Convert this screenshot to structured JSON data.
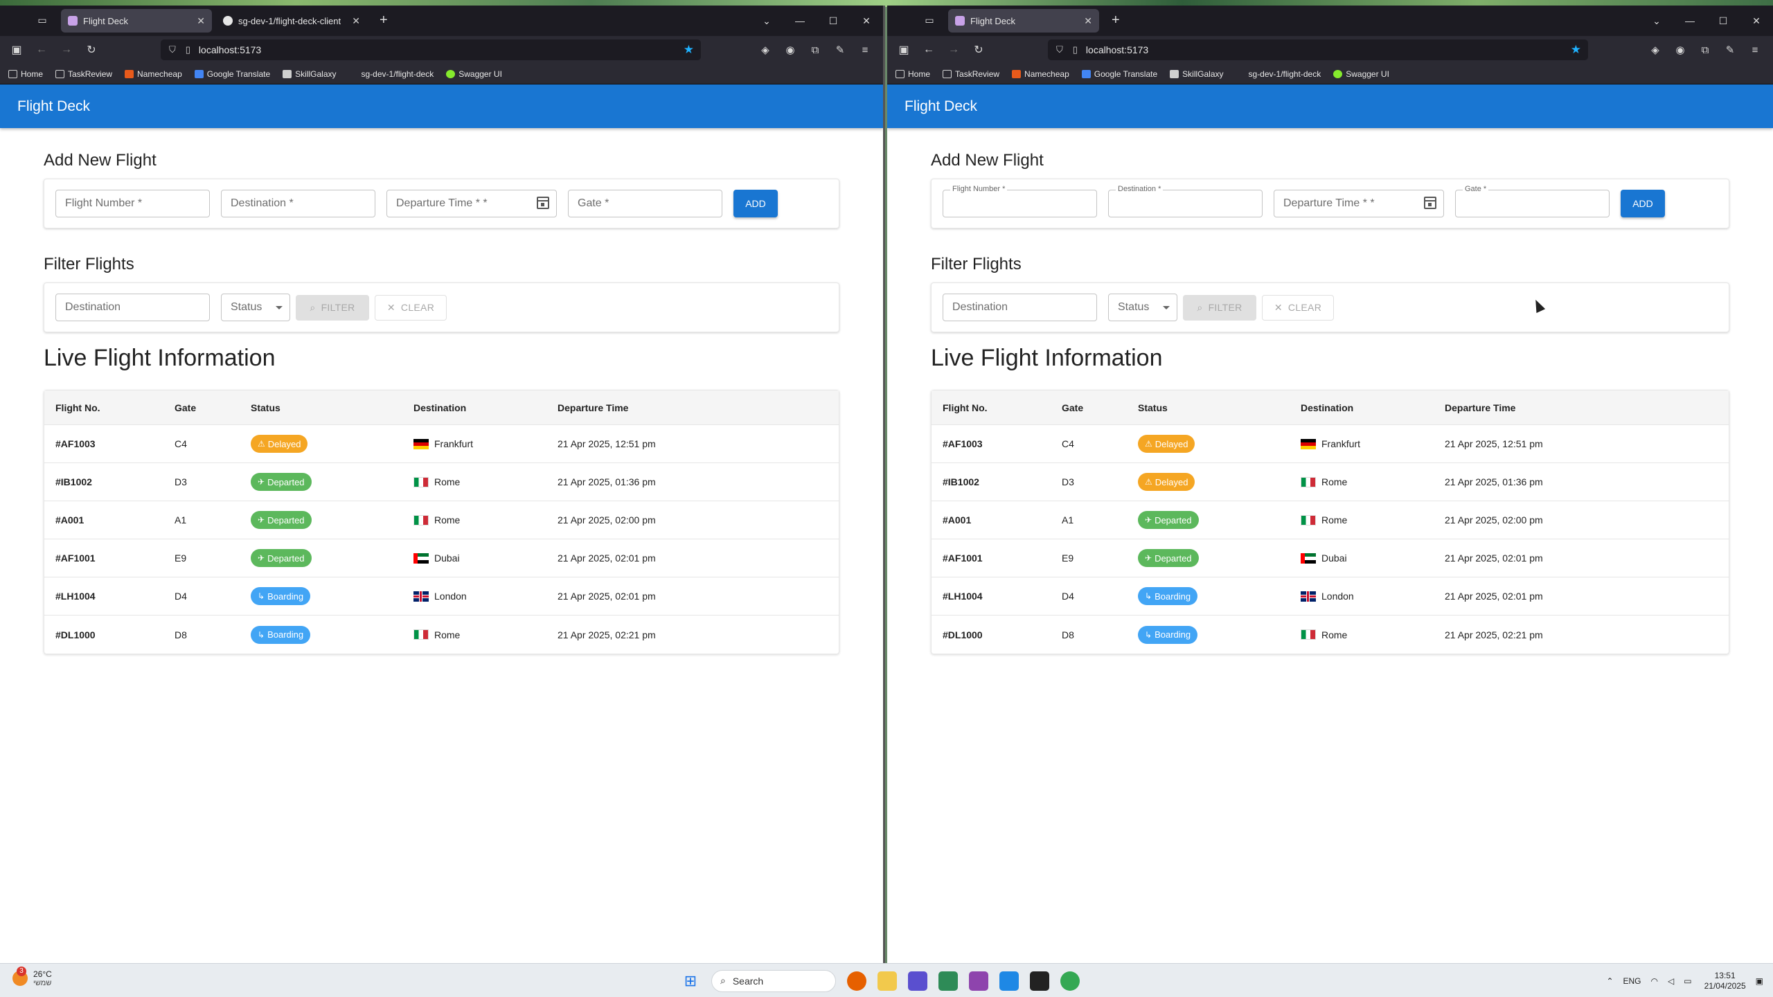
{
  "browser": {
    "left_tabs": [
      {
        "title": "Flight Deck",
        "active": true
      },
      {
        "title": "sg-dev-1/flight-deck-client",
        "active": false
      }
    ],
    "right_tabs": [
      {
        "title": "Flight Deck",
        "active": true
      }
    ],
    "new_tab_glyph": "+",
    "url": "localhost:5173",
    "bookmarks": [
      "Home",
      "TaskReview",
      "Namecheap",
      "Google Translate",
      "SkillGalaxy",
      "sg-dev-1/flight-deck",
      "Swagger UI"
    ]
  },
  "app": {
    "title": "Flight Deck",
    "add_section": {
      "title": "Add New Flight",
      "fields": [
        "Flight Number *",
        "Destination *",
        "Departure Time * *",
        "Gate *"
      ],
      "add_label": "ADD"
    },
    "filter_section": {
      "title": "Filter Flights",
      "destination_placeholder": "Destination",
      "status_label": "Status",
      "filter_label": "FILTER",
      "clear_label": "CLEAR"
    },
    "table_section": {
      "title": "Live Flight Information",
      "headers": [
        "Flight No.",
        "Gate",
        "Status",
        "Destination",
        "Departure Time"
      ]
    }
  },
  "left_flights": [
    {
      "flight": "#AF1003",
      "gate": "C4",
      "status": "Delayed",
      "destination": "Frankfurt",
      "time": "21 Apr 2025, 12:51 pm"
    },
    {
      "flight": "#IB1002",
      "gate": "D3",
      "status": "Departed",
      "destination": "Rome",
      "time": "21 Apr 2025, 01:36 pm"
    },
    {
      "flight": "#A001",
      "gate": "A1",
      "status": "Departed",
      "destination": "Rome",
      "time": "21 Apr 2025, 02:00 pm"
    },
    {
      "flight": "#AF1001",
      "gate": "E9",
      "status": "Departed",
      "destination": "Dubai",
      "time": "21 Apr 2025, 02:01 pm"
    },
    {
      "flight": "#LH1004",
      "gate": "D4",
      "status": "Boarding",
      "destination": "London",
      "time": "21 Apr 2025, 02:01 pm"
    },
    {
      "flight": "#DL1000",
      "gate": "D8",
      "status": "Boarding",
      "destination": "Rome",
      "time": "21 Apr 2025, 02:21 pm"
    }
  ],
  "right_flights": [
    {
      "flight": "#AF1003",
      "gate": "C4",
      "status": "Delayed",
      "destination": "Frankfurt",
      "time": "21 Apr 2025, 12:51 pm"
    },
    {
      "flight": "#IB1002",
      "gate": "D3",
      "status": "Delayed",
      "destination": "Rome",
      "time": "21 Apr 2025, 01:36 pm"
    },
    {
      "flight": "#A001",
      "gate": "A1",
      "status": "Departed",
      "destination": "Rome",
      "time": "21 Apr 2025, 02:00 pm"
    },
    {
      "flight": "#AF1001",
      "gate": "E9",
      "status": "Departed",
      "destination": "Dubai",
      "time": "21 Apr 2025, 02:01 pm"
    },
    {
      "flight": "#LH1004",
      "gate": "D4",
      "status": "Boarding",
      "destination": "London",
      "time": "21 Apr 2025, 02:01 pm"
    },
    {
      "flight": "#DL1000",
      "gate": "D8",
      "status": "Boarding",
      "destination": "Rome",
      "time": "21 Apr 2025, 02:21 pm"
    }
  ],
  "status_colors": {
    "Delayed": "#f5a623",
    "Departed": "#5cb85c",
    "Boarding": "#42a5f5"
  },
  "status_icons": {
    "Delayed": "warning-icon",
    "Departed": "plane-takeoff-icon",
    "Boarding": "boarding-icon"
  },
  "destination_flags": {
    "Frankfurt": "de",
    "Rome": "it",
    "Dubai": "ae",
    "London": "gb"
  },
  "colors": {
    "primary": "#1976d2",
    "browser_dark": "#1c1b22",
    "bookmark_star": "#1fb2ff"
  },
  "taskbar": {
    "weather_temp": "26°C",
    "weather_desc": "שמשי",
    "weather_badge": "3",
    "search_placeholder": "Search",
    "language": "ENG",
    "time": "13:51",
    "date": "21/04/2025"
  }
}
